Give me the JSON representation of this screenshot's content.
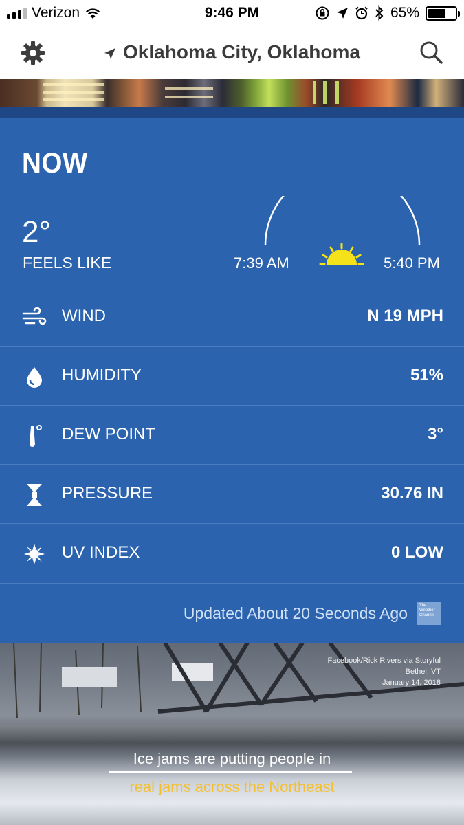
{
  "status_bar": {
    "carrier": "Verizon",
    "time": "9:46 PM",
    "battery": "65%",
    "battery_level": 0.65,
    "signal_bars": 3
  },
  "header": {
    "location": "Oklahoma City, Oklahoma",
    "icons": [
      "gear-icon",
      "location-arrow-icon",
      "search-icon"
    ]
  },
  "now": {
    "title": "NOW",
    "feels_like_value": "2°",
    "feels_like_label": "FEELS LIKE",
    "sunrise": "7:39 AM",
    "sunset": "5:40 PM"
  },
  "details": [
    {
      "label": "WIND",
      "value": "N 19 MPH",
      "icon": "wind-icon"
    },
    {
      "label": "HUMIDITY",
      "value": "51%",
      "icon": "humidity-drop-icon"
    },
    {
      "label": "DEW POINT",
      "value": "3°",
      "icon": "thermometer-icon"
    },
    {
      "label": "PRESSURE",
      "value": "30.76 IN",
      "icon": "pressure-icon"
    },
    {
      "label": "UV INDEX",
      "value": "0 LOW",
      "icon": "uv-sun-icon"
    }
  ],
  "updated": "Updated About 20 Seconds Ago",
  "twc_logo": {
    "line1": "The",
    "line2": "Weather",
    "line3": "Channel"
  },
  "video": {
    "credit_line1": "Facebook/Rick Rivers via Storyful",
    "credit_line2": "Bethel, VT",
    "credit_line3": "January 14, 2018",
    "caption_line1": "Ice jams are putting people in",
    "caption_line2": "real jams across the Northeast"
  },
  "colors": {
    "panel": "#2b63ae",
    "panel_dark": "#1f4786",
    "sun": "#f5e21a",
    "caption_highlight": "#f4c030"
  }
}
